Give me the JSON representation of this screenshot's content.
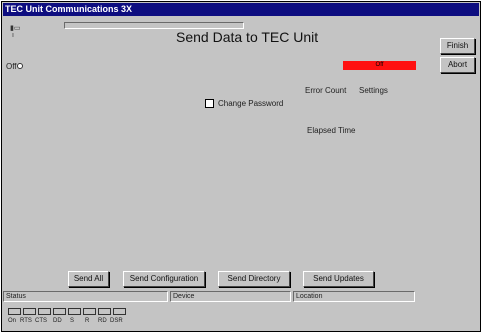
{
  "window": {
    "title": "TEC Unit Communications 3X"
  },
  "main": {
    "heading": "Send Data to TEC Unit",
    "progress_glyph": "ı",
    "off_label": "Off",
    "indicator_text": "Off",
    "change_password_label": "Change Password",
    "error_count_label": "Error Count",
    "settings_label": "Settings",
    "elapsed_time_label": "Elapsed Time"
  },
  "side_buttons": {
    "finish": "Finish",
    "abort": "Abort"
  },
  "bottom_buttons": {
    "send_all": "Send All",
    "send_configuration": "Send Configuration",
    "send_directory": "Send Directory",
    "send_updates": "Send Updates"
  },
  "status": {
    "status_label": "Status",
    "device_label": "Device",
    "location_label": "Location"
  },
  "leds": [
    "On",
    "RTS",
    "CTS",
    "DD",
    "S",
    "R",
    "RD",
    "DSR"
  ],
  "colors": {
    "titlebar": "#0d0d80",
    "indicator": "#ff1010"
  }
}
